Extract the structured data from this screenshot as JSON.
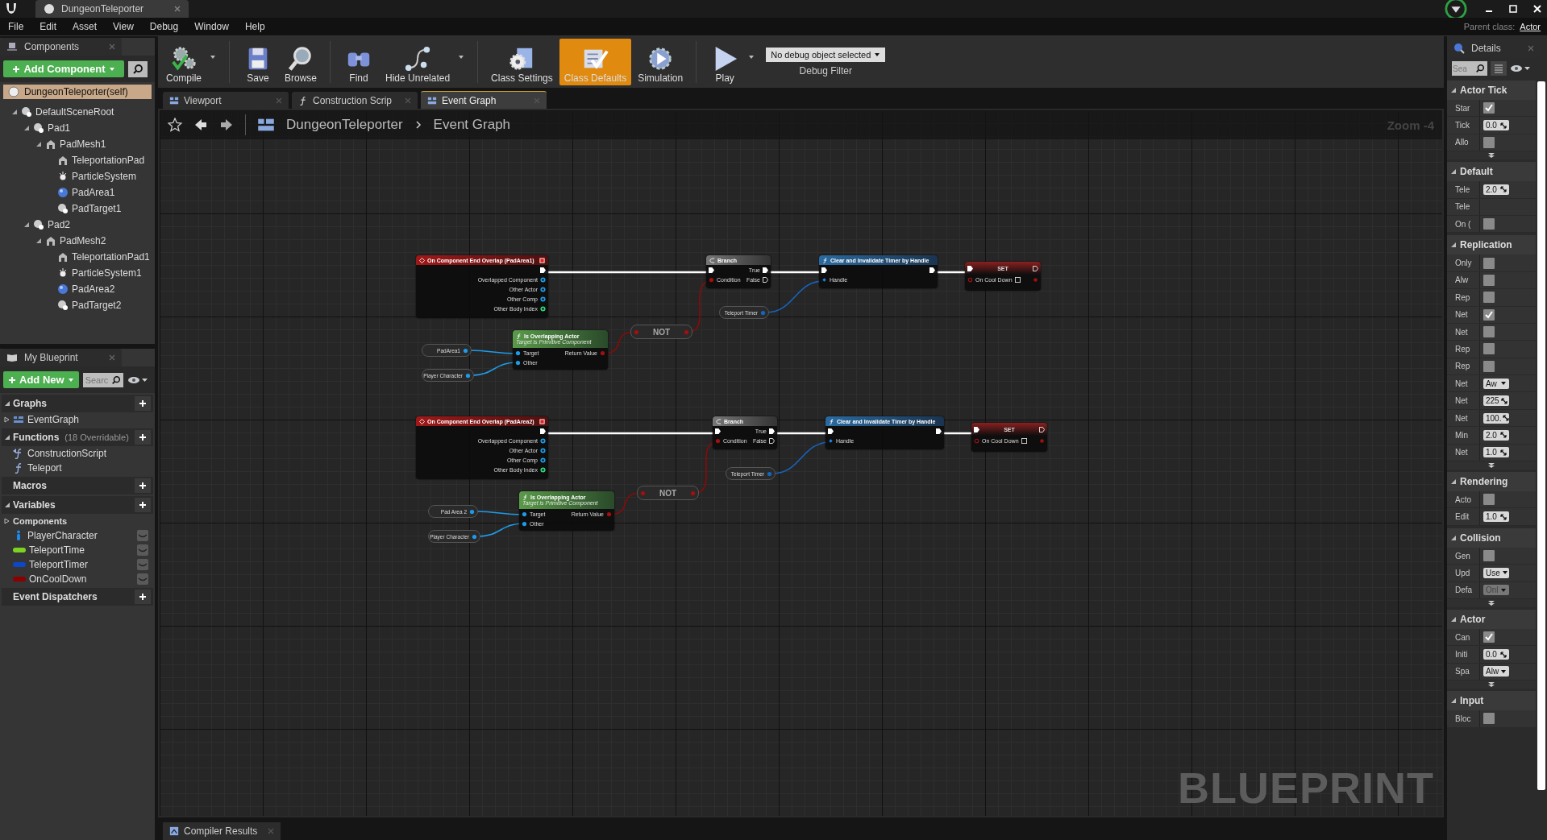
{
  "title_bar": {
    "tab_title": "DungeonTeleporter"
  },
  "menu": [
    "File",
    "Edit",
    "Asset",
    "View",
    "Debug",
    "Window",
    "Help"
  ],
  "parent_class": {
    "label": "Parent class:",
    "value": "Actor"
  },
  "components_panel": {
    "title": "Components",
    "add_button": "Add Component",
    "self_item": "DungeonTeleporter(self)",
    "tree": [
      {
        "label": "DefaultSceneRoot",
        "kind": "scene",
        "expanded": true,
        "children": [
          {
            "label": "Pad1",
            "kind": "scene",
            "expanded": true,
            "children": [
              {
                "label": "PadMesh1",
                "kind": "mesh",
                "expanded": true,
                "children": [
                  {
                    "label": "TeleportationPad",
                    "kind": "mesh"
                  },
                  {
                    "label": "ParticleSystem",
                    "kind": "particle"
                  },
                  {
                    "label": "PadArea1",
                    "kind": "sphere"
                  },
                  {
                    "label": "PadTarget1",
                    "kind": "scene"
                  }
                ]
              }
            ]
          },
          {
            "label": "Pad2",
            "kind": "scene",
            "expanded": true,
            "children": [
              {
                "label": "PadMesh2",
                "kind": "mesh",
                "expanded": true,
                "children": [
                  {
                    "label": "TeleportationPad1",
                    "kind": "mesh"
                  },
                  {
                    "label": "ParticleSystem1",
                    "kind": "particle"
                  },
                  {
                    "label": "PadArea2",
                    "kind": "sphere"
                  },
                  {
                    "label": "PadTarget2",
                    "kind": "scene"
                  }
                ]
              }
            ]
          }
        ]
      }
    ]
  },
  "my_blueprint": {
    "title": "My Blueprint",
    "add_button": "Add New",
    "search_placeholder": "Searc",
    "sections": [
      {
        "title": "Graphs",
        "expanded": true,
        "items": [
          {
            "label": "EventGraph",
            "kind": "graph",
            "expanded": false
          }
        ]
      },
      {
        "title": "Functions",
        "note": "(18 Overridable)",
        "expanded": true,
        "items": [
          {
            "label": "ConstructionScript",
            "kind": "construction"
          },
          {
            "label": "Teleport",
            "kind": "function"
          }
        ]
      },
      {
        "title": "Macros"
      },
      {
        "title": "Variables",
        "expanded": true,
        "items": [
          {
            "label": "Components",
            "kind": "category",
            "expanded": false
          },
          {
            "label": "PlayerCharacter",
            "kind": "object",
            "color": "#1e88e5"
          },
          {
            "label": "TeleportTime",
            "kind": "variable",
            "color": "#7ed321"
          },
          {
            "label": "TeleportTimer",
            "kind": "variable",
            "color": "#0d47c8"
          },
          {
            "label": "OnCoolDown",
            "kind": "variable",
            "color": "#8b0000"
          }
        ]
      },
      {
        "title": "Event Dispatchers"
      }
    ]
  },
  "toolbar": {
    "buttons": [
      {
        "label": "Compile",
        "kind": "compile",
        "selected": false,
        "menu": true
      },
      {
        "label": "Save",
        "kind": "save",
        "selected": false,
        "menu": false
      },
      {
        "label": "Browse",
        "kind": "browse",
        "selected": false,
        "menu": false
      },
      {
        "label": "Find",
        "kind": "find",
        "selected": false,
        "menu": false
      },
      {
        "label": "Hide Unrelated",
        "kind": "hide",
        "selected": false,
        "menu": true
      },
      {
        "label": "Class Settings",
        "kind": "settings",
        "selected": false,
        "menu": false
      },
      {
        "label": "Class Defaults",
        "kind": "defaults",
        "selected": true,
        "menu": false
      },
      {
        "label": "Simulation",
        "kind": "simulation",
        "selected": false,
        "menu": false
      },
      {
        "label": "Play",
        "kind": "play",
        "selected": false,
        "menu": true
      }
    ],
    "debug_filter": {
      "value": "No debug object selected",
      "label": "Debug Filter"
    }
  },
  "editor_tabs": [
    {
      "label": "Viewport",
      "kind": "viewport",
      "selected": false
    },
    {
      "label": "Construction Scrip",
      "kind": "function",
      "selected": false
    },
    {
      "label": "Event Graph",
      "kind": "graph",
      "selected": true
    }
  ],
  "graph": {
    "breadcrumb": [
      "DungeonTeleporter",
      "Event Graph"
    ],
    "zoom": "Zoom -4",
    "watermark": "BLUEPRINT",
    "groups": [
      {
        "event": {
          "title": "On Component End Overlap (PadArea1)",
          "outputs": [
            {
              "label": "Overlapped Component",
              "color": "#1e9be8"
            },
            {
              "label": "Other Actor",
              "color": "#1e9be8"
            },
            {
              "label": "Other Comp",
              "color": "#1e9be8"
            },
            {
              "label": "Other Body Index",
              "color": "#2fd67a"
            }
          ]
        },
        "branch": {
          "title": "Branch",
          "condition": "Condition",
          "true": "True",
          "false": "False"
        },
        "clear": {
          "title": "Clear and Invalidate Timer by Handle",
          "input": "Handle"
        },
        "set": {
          "title": "SET",
          "input": "On Cool Down",
          "checked": false
        },
        "timer": "Teleport Timer",
        "not": "NOT",
        "overlap": {
          "title": "Is Overlapping Actor",
          "subtitle": "Target is Primitive Component",
          "inputs": [
            "Target",
            "Other"
          ],
          "output": "Return Value"
        },
        "target_var": "PadArea1",
        "player_var": "Player Character"
      },
      {
        "event": {
          "title": "On Component End Overlap (PadArea2)",
          "outputs": [
            {
              "label": "Overlapped Component",
              "color": "#1e9be8"
            },
            {
              "label": "Other Actor",
              "color": "#1e9be8"
            },
            {
              "label": "Other Comp",
              "color": "#1e9be8"
            },
            {
              "label": "Other Body Index",
              "color": "#2fd67a"
            }
          ]
        },
        "branch": {
          "title": "Branch",
          "condition": "Condition",
          "true": "True",
          "false": "False"
        },
        "clear": {
          "title": "Clear and Invalidate Timer by Handle",
          "input": "Handle"
        },
        "set": {
          "title": "SET",
          "input": "On Cool Down",
          "checked": false
        },
        "timer": "Teleport Timer",
        "not": "NOT",
        "overlap": {
          "title": "Is Overlapping Actor",
          "subtitle": "Target is Primitive Component",
          "inputs": [
            "Target",
            "Other"
          ],
          "output": "Return Value"
        },
        "target_var": "Pad Area 2",
        "player_var": "Player Character"
      }
    ]
  },
  "bottom_tab": "Compiler Results",
  "details": {
    "title": "Details",
    "search_placeholder": "Sea",
    "sections": [
      {
        "title": "Actor Tick",
        "advanced": true,
        "rows": [
          {
            "label": "Star",
            "kind": "check",
            "checked": true
          },
          {
            "label": "Tick",
            "kind": "number",
            "value": "0.0"
          },
          {
            "label": "Allo",
            "kind": "check",
            "checked": false
          }
        ]
      },
      {
        "title": "Default",
        "advanced": false,
        "rows": [
          {
            "label": "Tele",
            "kind": "number",
            "value": "2.0"
          },
          {
            "label": "Tele",
            "kind": "none"
          },
          {
            "label": "On (",
            "kind": "check",
            "checked": false
          }
        ]
      },
      {
        "title": "Replication",
        "advanced": true,
        "rows": [
          {
            "label": "Only",
            "kind": "check",
            "checked": false
          },
          {
            "label": "Alw",
            "kind": "check",
            "checked": false
          },
          {
            "label": "Rep",
            "kind": "check",
            "checked": false
          },
          {
            "label": "Net",
            "kind": "check",
            "checked": true
          },
          {
            "label": "Net",
            "kind": "check",
            "checked": false
          },
          {
            "label": "Rep",
            "kind": "check",
            "checked": false
          },
          {
            "label": "Rep",
            "kind": "check",
            "checked": false
          },
          {
            "label": "Net",
            "kind": "dropdown",
            "value": "Aw",
            "disabled": false
          },
          {
            "label": "Net",
            "kind": "number",
            "value": "225"
          },
          {
            "label": "Net",
            "kind": "number",
            "value": "100."
          },
          {
            "label": "Min",
            "kind": "number",
            "value": "2.0"
          },
          {
            "label": "Net",
            "kind": "number",
            "value": "1.0"
          }
        ]
      },
      {
        "title": "Rendering",
        "advanced": false,
        "rows": [
          {
            "label": "Acto",
            "kind": "check",
            "checked": false
          },
          {
            "label": "Edit",
            "kind": "number",
            "value": "1.0"
          }
        ]
      },
      {
        "title": "Collision",
        "advanced": true,
        "rows": [
          {
            "label": "Gen",
            "kind": "check",
            "checked": false
          },
          {
            "label": "Upd",
            "kind": "dropdown",
            "value": "Use",
            "disabled": false
          },
          {
            "label": "Defa",
            "kind": "dropdown",
            "value": "Onl",
            "disabled": true
          }
        ]
      },
      {
        "title": "Actor",
        "advanced": true,
        "rows": [
          {
            "label": "Can",
            "kind": "check",
            "checked": true
          },
          {
            "label": "Initi",
            "kind": "number",
            "value": "0.0"
          },
          {
            "label": "Spa",
            "kind": "dropdown",
            "value": "Alw",
            "disabled": false
          }
        ]
      },
      {
        "title": "Input",
        "advanced": false,
        "rows": [
          {
            "label": "Bloc",
            "kind": "check",
            "checked": false
          }
        ]
      }
    ]
  }
}
